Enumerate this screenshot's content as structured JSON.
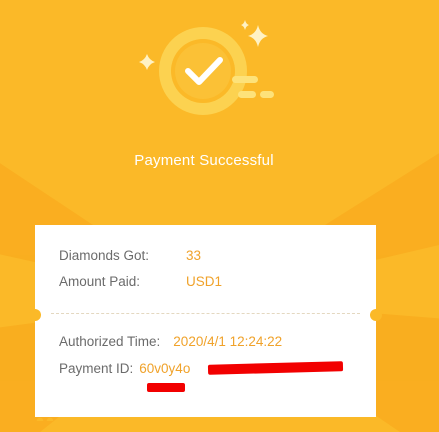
{
  "header": {
    "title": "Payment Successful"
  },
  "details": {
    "diamonds_label": "Diamonds Got:",
    "diamonds_value": "33",
    "amount_label": "Amount Paid:",
    "amount_value": "USD1",
    "time_label": "Authorized Time:",
    "time_value": "2020/4/1 12:24:22",
    "payment_id_label": "Payment ID:",
    "payment_id_value": "60v0y4o"
  },
  "icons": {
    "success": "check-circle-icon",
    "sparkle": "sparkle-icon"
  },
  "colors": {
    "background": "#fbb928",
    "accent": "#f0a22a",
    "icon": "#fde27a",
    "redaction": "#f20000"
  }
}
